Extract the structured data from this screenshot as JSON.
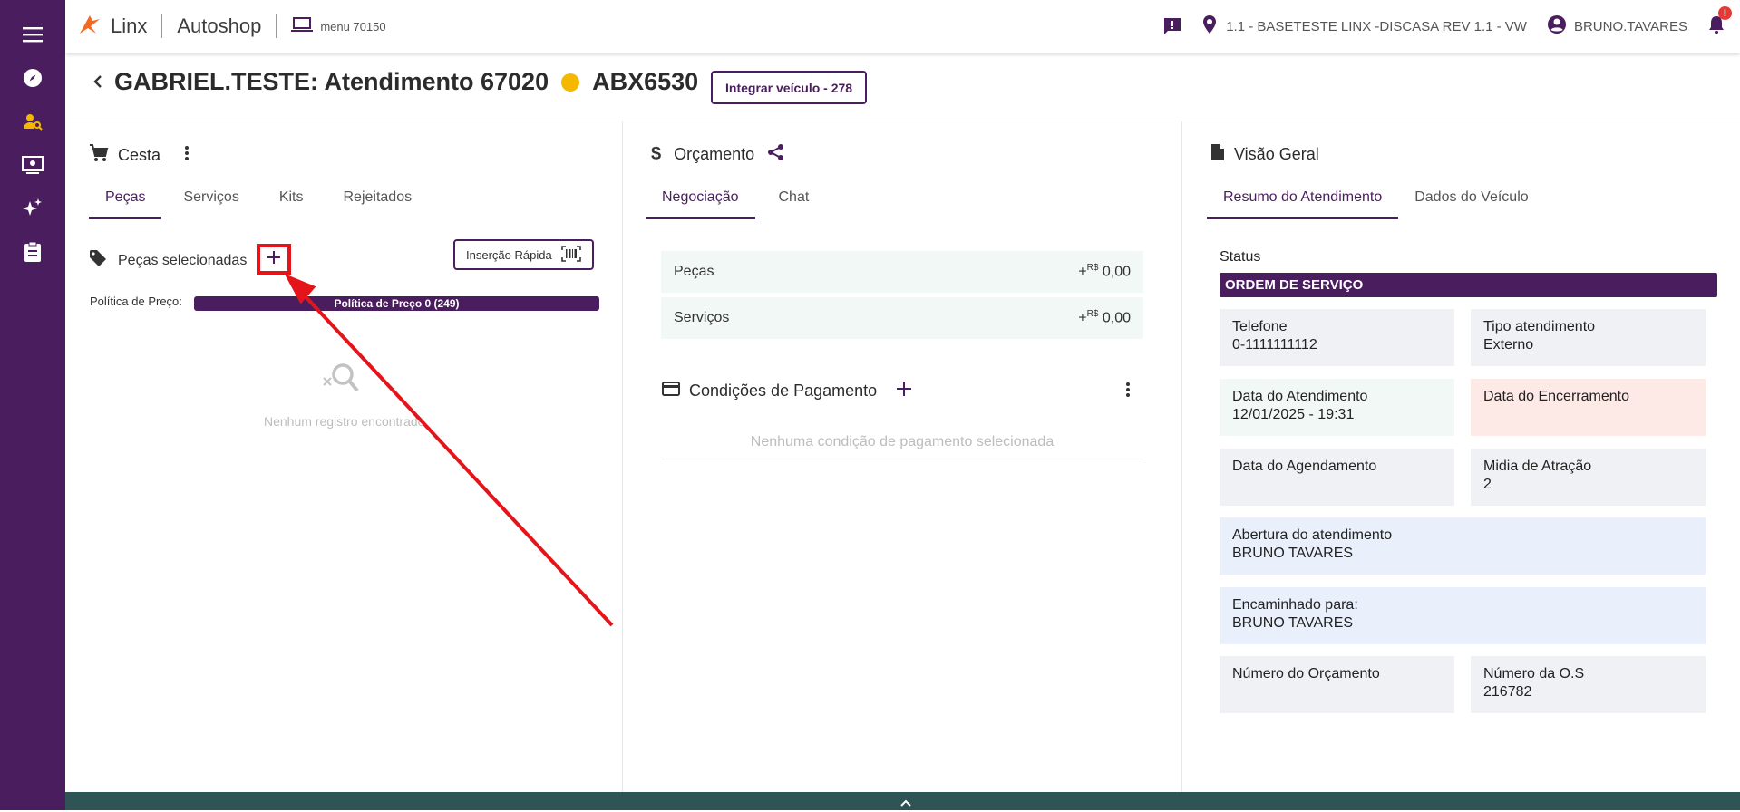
{
  "topbar": {
    "brand_name": "Linx",
    "product": "Autoshop",
    "menu_label": "menu 70150",
    "location": "1.1 - BASETESTE LINX -DISCASA REV 1.1 - VW",
    "user": "BRUNO.TAVARES",
    "notification_count": "!"
  },
  "header": {
    "title": "GABRIEL.TESTE: Atendimento 67020",
    "plate": "ABX6530",
    "integrate_button": "Integrar veículo - 278"
  },
  "cesta": {
    "title": "Cesta",
    "tabs": [
      "Peças",
      "Serviços",
      "Kits",
      "Rejeitados"
    ],
    "selected_label": "Peças selecionadas",
    "quick_insert": "Inserção Rápida",
    "policy_label": "Política de Preço:",
    "policy_value": "Política de Preço 0 (249)",
    "empty": "Nenhum registro encontrado"
  },
  "orcamento": {
    "title": "Orçamento",
    "tabs": [
      "Negociação",
      "Chat"
    ],
    "rows": [
      {
        "label": "Peças",
        "prefix": "+",
        "currency": "R$",
        "value": "0,00"
      },
      {
        "label": "Serviços",
        "prefix": "+",
        "currency": "R$",
        "value": "0,00"
      }
    ],
    "payment_title": "Condições de Pagamento",
    "payment_empty": "Nenhuma condição de pagamento selecionada"
  },
  "visao": {
    "title": "Visão Geral",
    "tabs": [
      "Resumo do Atendimento",
      "Dados do Veículo"
    ],
    "status_label": "Status",
    "status_value": "ORDEM DE SERVIÇO",
    "telefone_label": "Telefone",
    "telefone_value": "0-1111111112",
    "tipo_label": "Tipo atendimento",
    "tipo_value": "Externo",
    "data_atend_label": "Data do Atendimento",
    "data_atend_value": "12/01/2025 - 19:31",
    "data_enc_label": "Data do Encerramento",
    "data_agend_label": "Data do Agendamento",
    "midia_label": "Midia de Atração",
    "midia_value": "2",
    "abertura_label": "Abertura do atendimento",
    "abertura_value": "BRUNO TAVARES",
    "encaminhado_label": "Encaminhado para:",
    "encaminhado_value": "BRUNO TAVARES",
    "num_orc_label": "Número do Orçamento",
    "num_os_label": "Número da O.S",
    "num_os_value": "216782"
  },
  "colors": {
    "primary": "#4a1e5e",
    "accent_orange": "#f5b800",
    "annotation_red": "#e5141a"
  }
}
